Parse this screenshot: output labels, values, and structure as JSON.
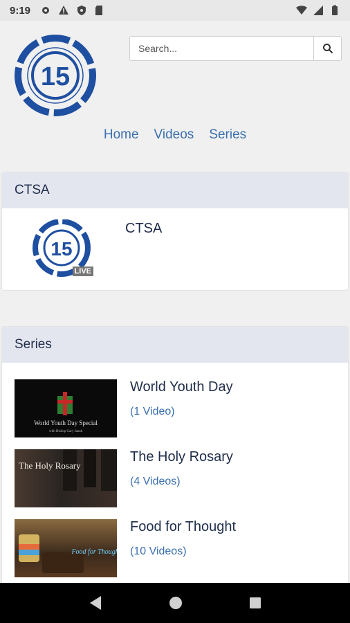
{
  "status_bar": {
    "time": "9:19",
    "left_icons": [
      "settings-icon",
      "warning-icon",
      "shield-icon",
      "sd-card-icon"
    ],
    "right_icons": [
      "wifi-icon",
      "signal-icon",
      "battery-icon"
    ]
  },
  "header": {
    "logo_alt": "15",
    "search": {
      "placeholder": "Search...",
      "value": ""
    }
  },
  "nav": {
    "items": [
      {
        "label": "Home"
      },
      {
        "label": "Videos"
      },
      {
        "label": "Series"
      }
    ]
  },
  "live_section": {
    "header": "CTSA",
    "channel": {
      "title": "CTSA",
      "badge": "LIVE"
    }
  },
  "series_section": {
    "header": "Series",
    "items": [
      {
        "title": "World Youth Day",
        "count": "(1 Video)",
        "thumb_caption": "World Youth Day Special",
        "thumb_sub": "with Bishop Gary Janak"
      },
      {
        "title": "The Holy Rosary",
        "count": "(4 Videos)",
        "thumb_caption": "The Holy Rosary"
      },
      {
        "title": "Food for Thought",
        "count": "(10 Videos)",
        "thumb_caption": "Food for Thought"
      }
    ]
  },
  "colors": {
    "accent": "#3a6fae",
    "brand_blue": "#1f4fa0",
    "header_bg": "#e4e6ef"
  }
}
